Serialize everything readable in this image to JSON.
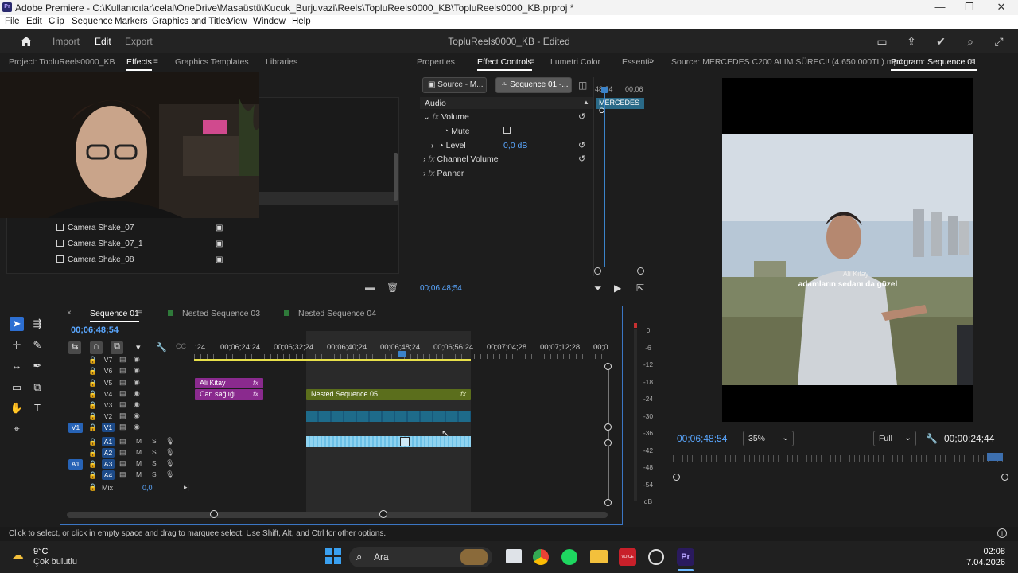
{
  "window": {
    "title": "Adobe Premiere - C:\\Kullanıcılar\\celal\\OneDrive\\Masaüstü\\Kucuk_Burjuvazi\\Reels\\TopluReels0000_KB\\TopluReels0000_KB.prproj *",
    "app_icon": "Pr",
    "controls": [
      "minimize-icon",
      "maximize-icon",
      "close-icon"
    ]
  },
  "menu": [
    "File",
    "Edit",
    "Clip",
    "Sequence",
    "Markers",
    "Graphics and Titles",
    "View",
    "Window",
    "Help"
  ],
  "header": {
    "workspaces": [
      "Import",
      "Edit",
      "Export"
    ],
    "active_workspace": "Edit",
    "project_title": "TopluReels0000_KB - Edited",
    "right_icons": [
      "panel-icon",
      "share-icon",
      "check-circle-icon",
      "search-icon",
      "fullscreen-icon"
    ]
  },
  "project_panel": {
    "tabs": [
      "Project: TopluReels0000_KB",
      "Effects",
      "Graphics Templates",
      "Libraries"
    ],
    "active_tab": "Effects",
    "items": [
      "Camera Shake_07",
      "Camera Shake_07_1",
      "Camera Shake_08"
    ]
  },
  "effect_controls": {
    "tabs": [
      "Properties",
      "Effect Controls",
      "Lumetri Color",
      "Essenti"
    ],
    "active_tab": "Effect Controls",
    "source_btn": "Source - M...",
    "sequence_btn": "Sequence 01 -...",
    "section": "Audio",
    "rows": [
      {
        "label": "Volume",
        "fx": "fx"
      },
      {
        "label": "Mute",
        "value": ""
      },
      {
        "label": "Level",
        "value": "0,0 dB"
      },
      {
        "label": "Channel Volume",
        "fx": "fx"
      },
      {
        "label": "Panner",
        "fx": "fx"
      }
    ],
    "mini_ruler": [
      "48:24",
      "00;06"
    ],
    "mini_clip": "MERCEDES C",
    "timecode": "00;06;48;54"
  },
  "source_monitor": {
    "title": "Source: MERCEDES C200 ALIM SÜRECİ! (4.650.000TL).mp4"
  },
  "program_monitor": {
    "title": "Program: Sequence 01",
    "timecode": "00;06;48;54",
    "zoom": "35%",
    "quality": "Full",
    "duration": "00;00;24;44",
    "caption_name": "Ali Kitay",
    "caption_text": "adamların sedanı da güzel"
  },
  "timeline": {
    "tabs": [
      "Sequence 01",
      "Nested Sequence 03",
      "Nested Sequence 04"
    ],
    "active_tab": "Sequence 01",
    "timecode": "00;06;48;54",
    "ruler": [
      ";24",
      "00;06;24;24",
      "00;06;32;24",
      "00;06;40;24",
      "00;06;48;24",
      "00;06;56;24",
      "00;07;04;28",
      "00;07;12;28",
      "00;0"
    ],
    "video_tracks": [
      "V7",
      "V6",
      "V5",
      "V4",
      "V3",
      "V2",
      "V1"
    ],
    "audio_tracks": [
      "A1",
      "A2",
      "A3",
      "A4"
    ],
    "mix_label": "Mix",
    "mix_value": "0,0",
    "clips": {
      "title1": "Ali Kitay",
      "title2": "Can sağlığı",
      "nested": "Nested Sequence 05",
      "fx": "fx"
    },
    "meter_scale": [
      "0",
      "-6",
      "-12",
      "-18",
      "-24",
      "-30",
      "-36",
      "-42",
      "-48",
      "-54",
      "dB"
    ]
  },
  "status_bar": "Click to select, or click in empty space and drag to marquee select. Use Shift, Alt, and Ctrl for other options.",
  "taskbar": {
    "weather_temp": "9°C",
    "weather_desc": "Çok bulutlu",
    "search": "Ara",
    "time": "02:08",
    "date": "7.04.2026"
  },
  "colors": {
    "accent_blue": "#2d8ceb",
    "clip_magenta": "#8a2a8e",
    "clip_olive": "#5b6e1c",
    "clip_teal": "#1e6b8a",
    "audio_clip": "#8fd3f0"
  }
}
